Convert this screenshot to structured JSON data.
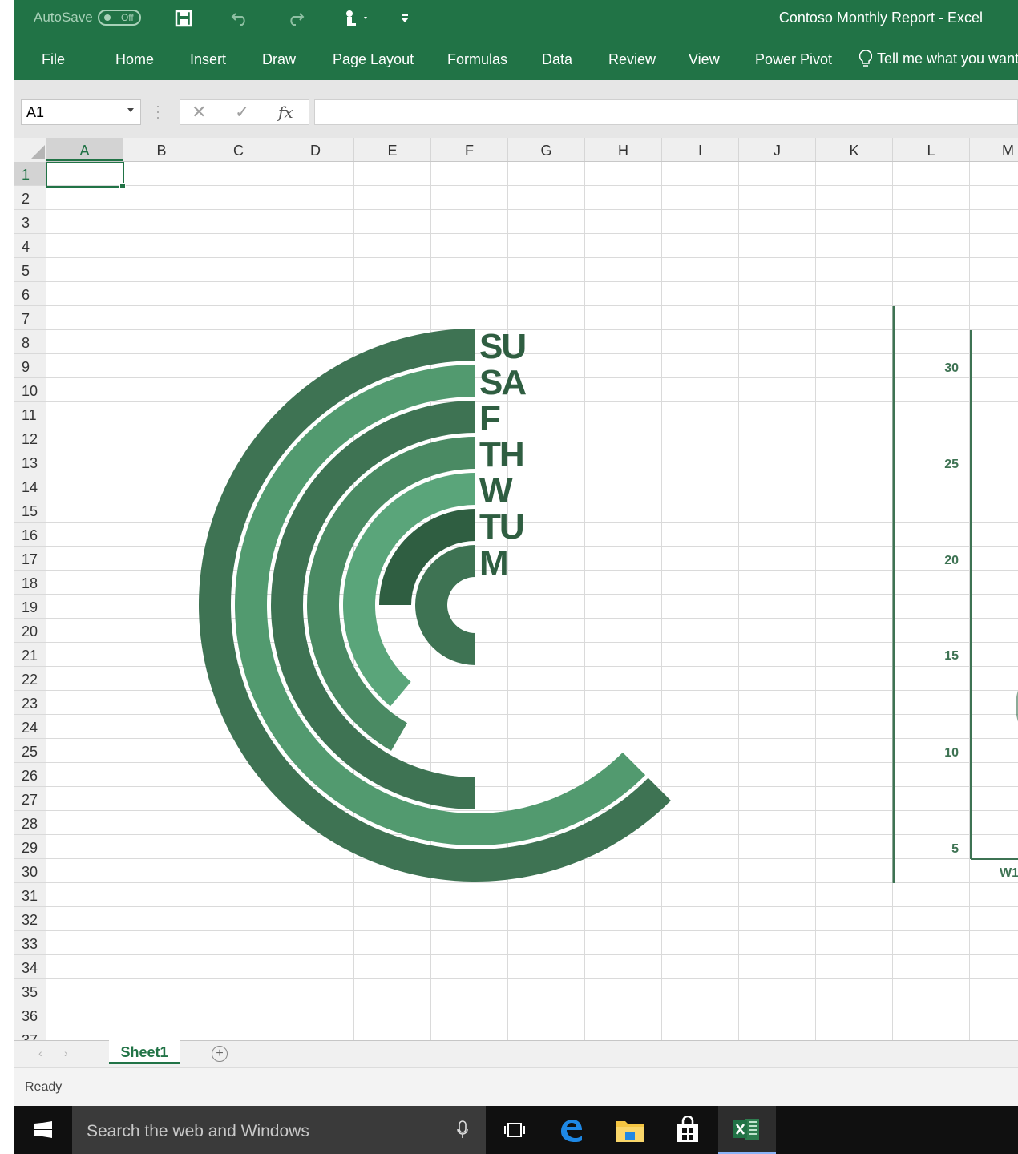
{
  "titlebar": {
    "autosave_label": "AutoSave",
    "autosave_state": "Off",
    "document_title": "Contoso Monthly Report  -  Excel",
    "quick_access_icons": [
      "save-icon",
      "undo-icon",
      "redo-icon",
      "touch-mode-icon",
      "customize-icon"
    ]
  },
  "ribbon": {
    "tabs": [
      "File",
      "Home",
      "Insert",
      "Draw",
      "Page Layout",
      "Formulas",
      "Data",
      "Review",
      "View",
      "Power Pivot"
    ],
    "tell_me": "Tell me what you want"
  },
  "formula_bar": {
    "name_box": "A1",
    "fx_label": "fx",
    "formula": ""
  },
  "grid": {
    "columns": [
      "A",
      "B",
      "C",
      "D",
      "E",
      "F",
      "G",
      "H",
      "I",
      "J",
      "K",
      "L",
      "M"
    ],
    "rows": [
      "1",
      "2",
      "3",
      "4",
      "5",
      "6",
      "7",
      "8",
      "9",
      "10",
      "11",
      "12",
      "13",
      "14",
      "15",
      "16",
      "17",
      "18",
      "19",
      "20",
      "21",
      "22",
      "23",
      "24",
      "25",
      "26",
      "27",
      "28",
      "29",
      "30",
      "31",
      "32",
      "33",
      "34",
      "35",
      "36",
      "37"
    ],
    "selected_cell": "A1"
  },
  "chart_data": [
    {
      "type": "radial-bar",
      "categories": [
        "SU",
        "SA",
        "F",
        "TH",
        "W",
        "TU",
        "M"
      ],
      "sweep_degrees": [
        225,
        225,
        180,
        150,
        140,
        90,
        180
      ],
      "colors": [
        "#3e7353",
        "#529a6f",
        "#3e7353",
        "#4a8a63",
        "#5aa57a",
        "#2f5e41",
        "#3e7353"
      ]
    },
    {
      "type": "bar",
      "y_ticks": [
        "30",
        "25",
        "20",
        "15",
        "10",
        "5"
      ],
      "x_labels": [
        "W1"
      ]
    }
  ],
  "sheets": {
    "tabs": [
      "Sheet1"
    ],
    "active": "Sheet1"
  },
  "status": {
    "text": "Ready"
  },
  "taskbar": {
    "search_placeholder": "Search the web and Windows",
    "apps": [
      "task-view-icon",
      "edge-icon",
      "file-explorer-icon",
      "store-icon",
      "excel-icon"
    ]
  },
  "colors": {
    "accent": "#217346",
    "chart_dark": "#3e7353",
    "chart_light": "#529a6f"
  }
}
